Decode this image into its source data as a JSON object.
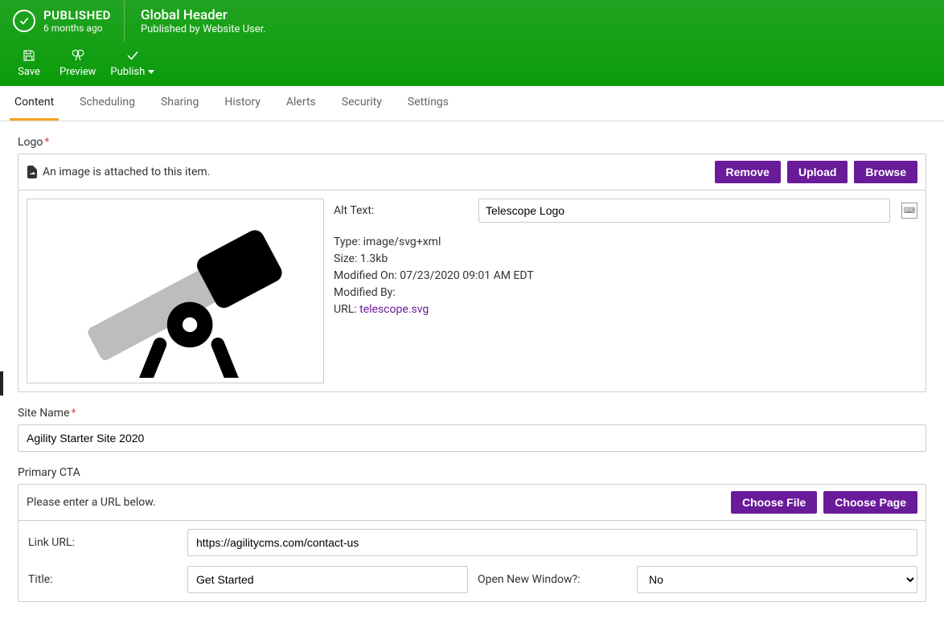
{
  "header": {
    "status": "PUBLISHED",
    "status_sub": "6 months ago",
    "title": "Global Header",
    "subtitle": "Published by Website User."
  },
  "toolbar": {
    "save": "Save",
    "preview": "Preview",
    "publish": "Publish"
  },
  "tabs": [
    "Content",
    "Scheduling",
    "Sharing",
    "History",
    "Alerts",
    "Security",
    "Settings"
  ],
  "logo": {
    "label": "Logo",
    "attached_msg": "An image is attached to this item.",
    "remove": "Remove",
    "upload": "Upload",
    "browse": "Browse",
    "alt_label": "Alt Text:",
    "alt_value": "Telescope Logo",
    "type_label": "Type:",
    "type_value": "image/svg+xml",
    "size_label": "Size:",
    "size_value": "1.3kb",
    "modon_label": "Modified On:",
    "modon_value": "07/23/2020 09:01 AM EDT",
    "modby_label": "Modified By:",
    "modby_value": "",
    "url_label": "URL:",
    "url_value": "telescope.svg"
  },
  "site_name": {
    "label": "Site Name",
    "value": "Agility Starter Site 2020"
  },
  "cta": {
    "label": "Primary CTA",
    "hint": "Please enter a URL below.",
    "choose_file": "Choose File",
    "choose_page": "Choose Page",
    "link_url_label": "Link URL:",
    "link_url_value": "https://agilitycms.com/contact-us",
    "title_label": "Title:",
    "title_value": "Get Started",
    "open_label": "Open New Window?:",
    "open_value": "No"
  }
}
